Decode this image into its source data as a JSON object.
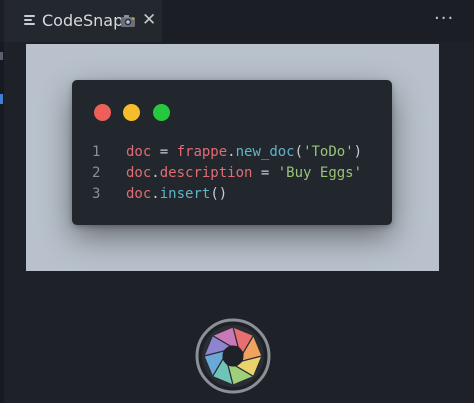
{
  "tab": {
    "title": "CodeSnap",
    "icon": "list-icon",
    "badge_icon": "camera-icon",
    "close_symbol": "✕"
  },
  "toolbar": {
    "more_symbol": "···"
  },
  "window_controls": {
    "colors": [
      "#ef5f5a",
      "#f5bd2e",
      "#27c840"
    ]
  },
  "code": {
    "lines": [
      {
        "num": "1",
        "tokens": [
          {
            "text": "doc",
            "kind": "var"
          },
          {
            "text": " = ",
            "kind": "op"
          },
          {
            "text": "frappe",
            "kind": "var"
          },
          {
            "text": ".",
            "kind": "op"
          },
          {
            "text": "new_doc",
            "kind": "fn"
          },
          {
            "text": "(",
            "kind": "op"
          },
          {
            "text": "'ToDo'",
            "kind": "str"
          },
          {
            "text": ")",
            "kind": "op"
          }
        ]
      },
      {
        "num": "2",
        "tokens": [
          {
            "text": "doc",
            "kind": "var"
          },
          {
            "text": ".",
            "kind": "op"
          },
          {
            "text": "description",
            "kind": "var"
          },
          {
            "text": " = ",
            "kind": "op"
          },
          {
            "text": "'Buy Eggs'",
            "kind": "str"
          }
        ]
      },
      {
        "num": "3",
        "tokens": [
          {
            "text": "doc",
            "kind": "var"
          },
          {
            "text": ".",
            "kind": "op"
          },
          {
            "text": "insert",
            "kind": "fn"
          },
          {
            "text": "()",
            "kind": "op"
          }
        ]
      }
    ]
  },
  "shutter_button": {
    "icon": "aperture-icon"
  },
  "colors": {
    "stage_background": "#b9c2cc",
    "editor_background": "#1e2128",
    "code_window": "#22262d"
  }
}
